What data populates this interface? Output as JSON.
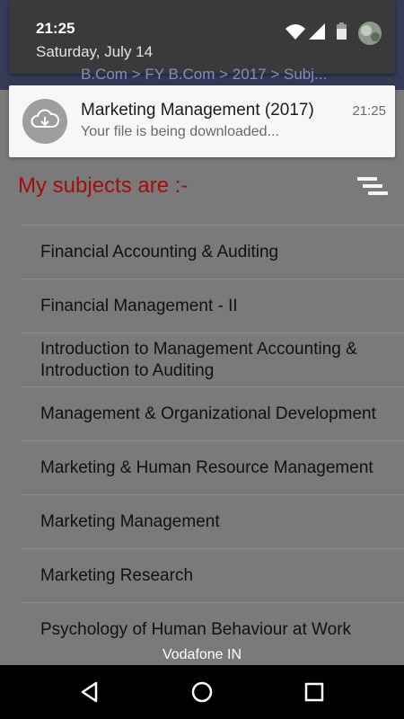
{
  "status_bar": {
    "time": "21:25",
    "date": "Saturday, July 14",
    "icons": [
      "wifi-icon",
      "signal-icon",
      "battery-icon",
      "avatar"
    ]
  },
  "notification": {
    "title": "Marketing Management (2017)",
    "time": "21:25",
    "text": "Your file is being downloaded...",
    "icon": "cloud-download-icon"
  },
  "app": {
    "breadcrumb": "B.Com  >  FY B.Com  >  2017  >  Subj...",
    "heading": "My subjects are :-",
    "menu_icon": "list-menu-icon",
    "subjects": [
      "Financial Accounting & Auditing",
      "Financial Management - II",
      "Introduction to Management Accounting & Introduction to Auditing",
      "Management & Organizational Development",
      "Marketing & Human Resource Management",
      "Marketing Management",
      "Marketing Research",
      "Psychology of Human Behaviour at Work"
    ]
  },
  "carrier": "Vodafone IN",
  "navbar": {
    "buttons": [
      "back-icon",
      "home-icon",
      "recents-icon"
    ]
  },
  "colors": {
    "heading": "#a50c0c",
    "header_bg": "#2a3a78",
    "scrim": "#7a7a7a"
  }
}
